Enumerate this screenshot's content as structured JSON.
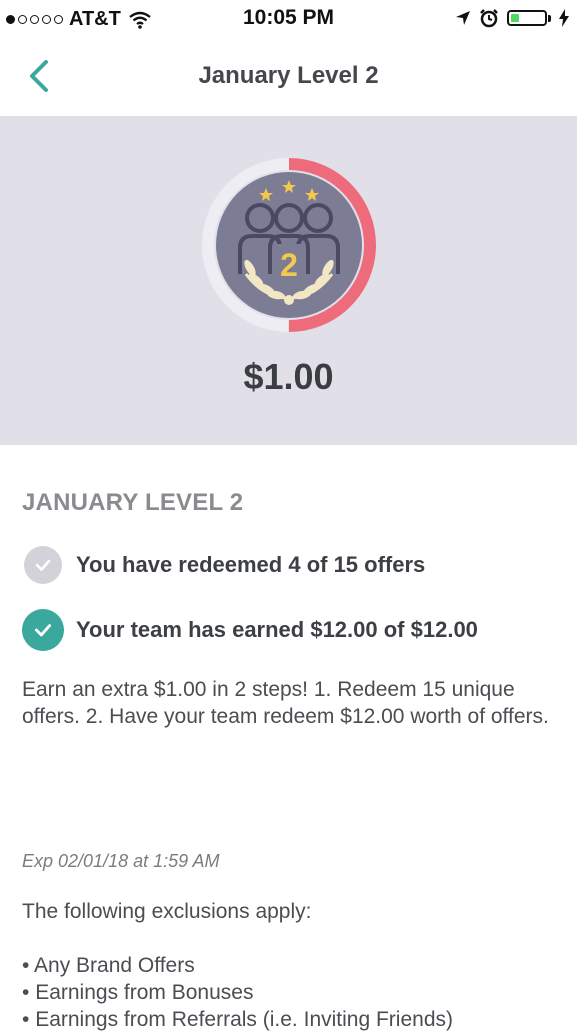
{
  "status_bar": {
    "carrier": "AT&T",
    "time": "10:05 PM",
    "signal_bars_filled": 1,
    "signal_bars_total": 5,
    "battery_level_fraction": 0.25
  },
  "nav": {
    "title": "January Level 2",
    "back_icon": "chevron-left-icon"
  },
  "hero": {
    "amount": "$1.00",
    "level_number": "2",
    "progress_fraction": 0.5,
    "progress_color": "#ee6b7b",
    "badge_color": "#7d7c95",
    "track_color": "#eeedf3"
  },
  "section": {
    "title": "JANUARY LEVEL 2",
    "requirements": [
      {
        "label": "You have redeemed 4 of 15 offers",
        "completed": false
      },
      {
        "label": "Your team has earned $12.00 of $12.00",
        "completed": true
      }
    ],
    "description": "Earn an extra $1.00 in 2 steps! 1. Redeem 15 unique offers. 2. Have your team redeem $12.00 worth of offers.",
    "expiration": "Exp 02/01/18 at 1:59 AM",
    "exclusions_title": "The following exclusions apply:",
    "exclusions": [
      "Any Brand Offers",
      "Earnings from Bonuses",
      "Earnings from Referrals (i.e. Inviting Friends)"
    ]
  },
  "colors": {
    "accent": "#3aa89c",
    "progress": "#ee6b7b",
    "hero_bg": "#e1e0e8"
  }
}
